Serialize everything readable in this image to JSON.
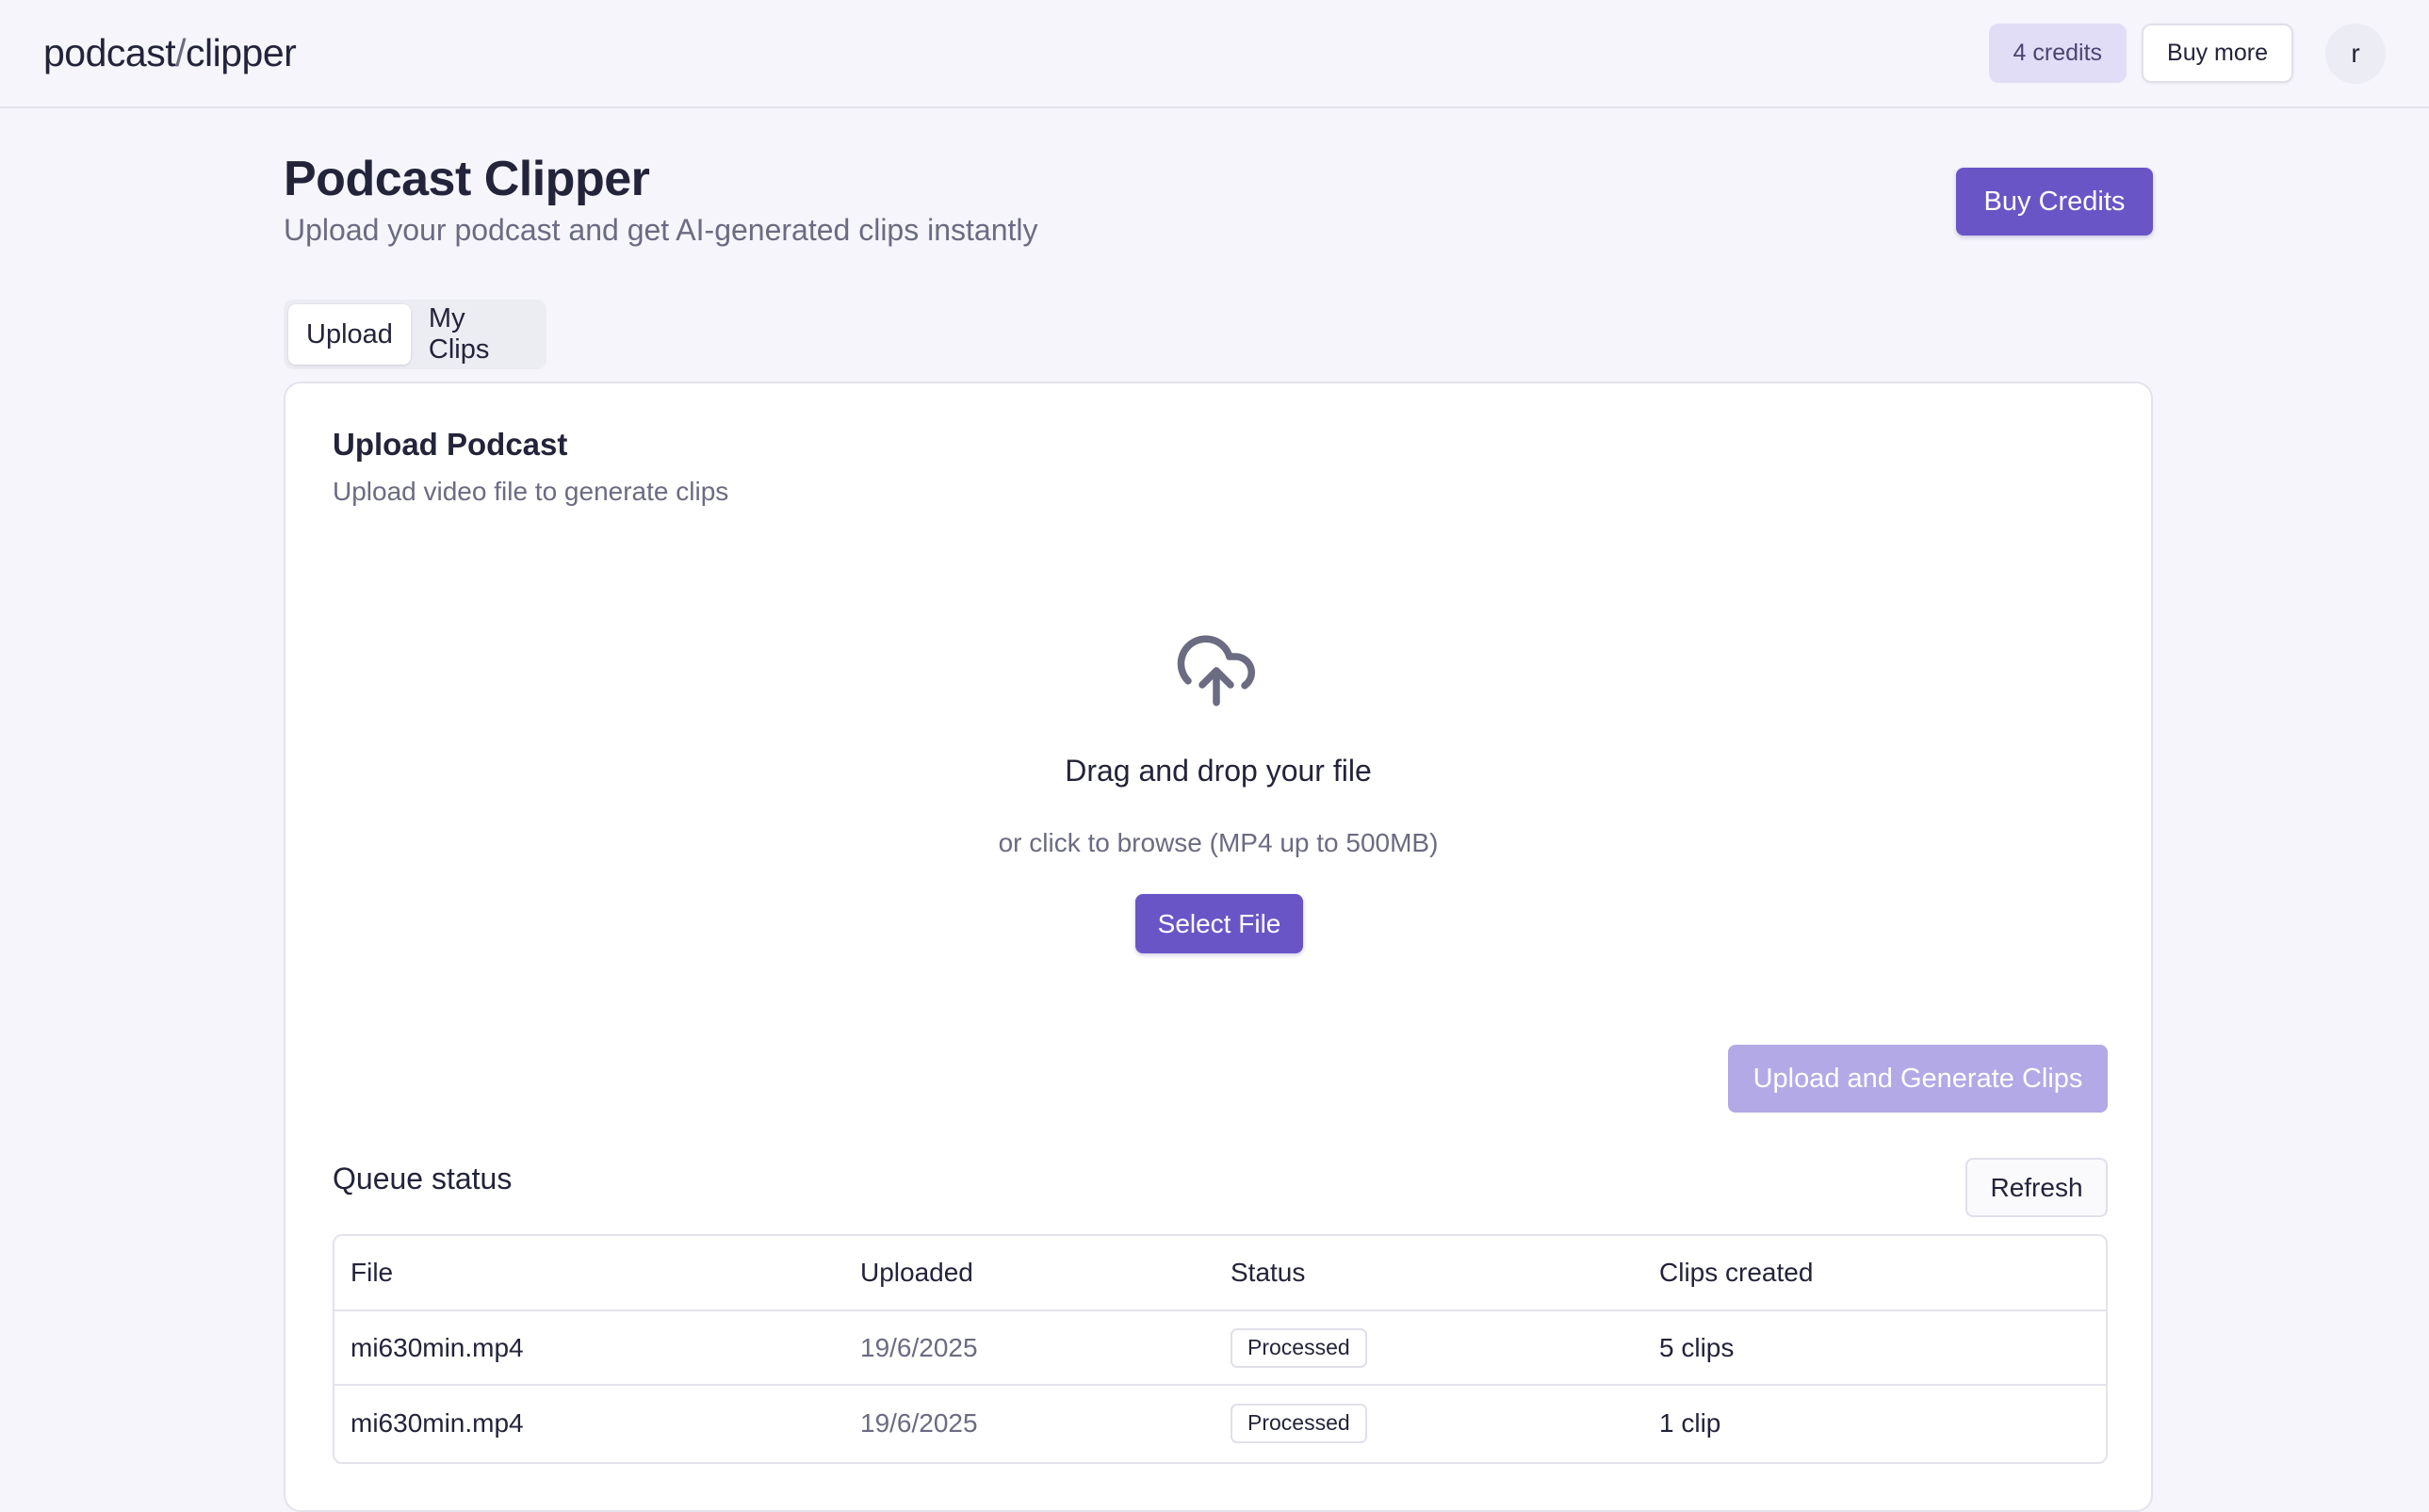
{
  "header": {
    "brand_part1": "podcast",
    "brand_sep": "/",
    "brand_part2": "clipper",
    "credits_label": "4 credits",
    "buy_more_label": "Buy more",
    "avatar_initial": "r"
  },
  "page": {
    "title": "Podcast Clipper",
    "subtitle": "Upload your podcast and get AI-generated clips instantly",
    "buy_credits_label": "Buy Credits"
  },
  "tabs": [
    {
      "label": "Upload",
      "active": true
    },
    {
      "label": "My Clips",
      "active": false
    }
  ],
  "upload_card": {
    "title": "Upload Podcast",
    "description": "Upload video file to generate clips",
    "dropzone": {
      "icon": "cloud-upload-icon",
      "title": "Drag and drop your file",
      "hint": "or click to browse (MP4 up to 500MB)",
      "select_label": "Select File"
    },
    "generate_label": "Upload and Generate Clips"
  },
  "queue": {
    "title": "Queue status",
    "refresh_label": "Refresh",
    "columns": [
      "File",
      "Uploaded",
      "Status",
      "Clips created"
    ],
    "rows": [
      {
        "file": "mi630min.mp4",
        "uploaded": "19/6/2025",
        "status": "Processed",
        "clips": "5 clips"
      },
      {
        "file": "mi630min.mp4",
        "uploaded": "19/6/2025",
        "status": "Processed",
        "clips": "1 clip"
      }
    ]
  },
  "colors": {
    "accent": "#6a55c7",
    "accent_disabled": "#b3a9e6",
    "credits_pill_bg": "#e2ddf7",
    "background": "#f5f5fb"
  }
}
